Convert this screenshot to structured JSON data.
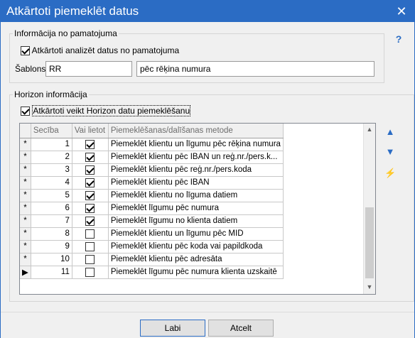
{
  "window": {
    "title": "Atkārtoti piemeklēt datus"
  },
  "icons": {
    "close": "✕",
    "help": "?",
    "up": "▲",
    "down": "▼",
    "bolt": "⚡"
  },
  "basis": {
    "legend": "Informācija no pamatojuma",
    "reanalyze_label": "Atkārtoti analizēt datus no pamatojuma",
    "reanalyze_checked": true,
    "template_label": "Šablons",
    "template_code": "RR",
    "template_name": "pēc rēķina numura"
  },
  "horizon": {
    "legend": "Horizon informācija",
    "rematch_label": "Atkārtoti veikt Horizon datu piemeklēšanu",
    "rematch_checked": true
  },
  "grid": {
    "columns": [
      "Secība",
      "Vai lietot",
      "Piemeklēšanas/dalīšanas metode"
    ],
    "rows": [
      {
        "indicator": "*",
        "order": "1",
        "use": true,
        "method": "Piemeklēt klientu un līgumu pēc rēķina numura"
      },
      {
        "indicator": "*",
        "order": "2",
        "use": true,
        "method": "Piemeklēt klientu pēc IBAN un reģ.nr./pers.k..."
      },
      {
        "indicator": "*",
        "order": "3",
        "use": true,
        "method": "Piemeklēt klientu pēc reģ.nr./pers.koda"
      },
      {
        "indicator": "*",
        "order": "4",
        "use": true,
        "method": "Piemeklēt klientu pēc IBAN"
      },
      {
        "indicator": "*",
        "order": "5",
        "use": true,
        "method": "Piemeklēt klientu no līguma datiem"
      },
      {
        "indicator": "*",
        "order": "6",
        "use": true,
        "method": "Piemeklēt līgumu pēc numura"
      },
      {
        "indicator": "*",
        "order": "7",
        "use": true,
        "method": "Piemeklēt līgumu no klienta datiem"
      },
      {
        "indicator": "*",
        "order": "8",
        "use": false,
        "method": "Piemeklēt klientu un līgumu pēc MID"
      },
      {
        "indicator": "*",
        "order": "9",
        "use": false,
        "method": "Piemeklēt klientu pēc koda vai papildkoda"
      },
      {
        "indicator": "*",
        "order": "10",
        "use": false,
        "method": "Piemeklēt klientu pēc adresāta"
      },
      {
        "indicator": "▶",
        "order": "11",
        "use": false,
        "method": "Piemeklēt līgumu pēc numura klienta uzskaitē"
      }
    ]
  },
  "footer": {
    "ok_label": "Labi",
    "cancel_label": "Atcelt"
  }
}
